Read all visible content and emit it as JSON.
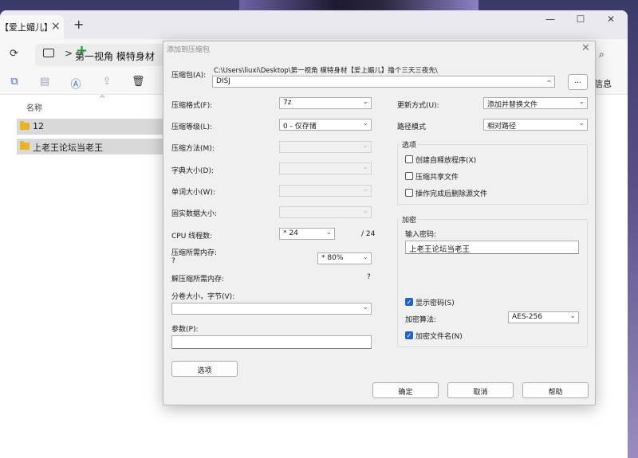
{
  "explorer": {
    "tab_title": "【爱上媚儿】",
    "tab_close": "×",
    "tab_add": "+",
    "win_controls": [
      "—",
      "☐",
      "✕"
    ],
    "refresh_icon": "refresh-icon",
    "breadcrumb_chev": ">",
    "breadcrumb": "第一视角 模特身材",
    "search_icon": "⌕",
    "toolbar_info": "信息",
    "column_name": "名称",
    "sort_caret": "^",
    "files": [
      "12",
      "上老王论坛当老王"
    ]
  },
  "dialog": {
    "title": "添加到压缩包",
    "close": "✕",
    "archive_label": "压缩包(A):",
    "archive_path": "C:\\Users\\liuxi\\Desktop\\第一视角 模特身材【爱上媚儿】撸个三天三夜先\\",
    "archive_name": "DISJ",
    "browse": "...",
    "left": {
      "format_label": "压缩格式(F):",
      "format_value": "7z",
      "level_label": "压缩等级(L):",
      "level_value": "0 - 仅存储",
      "method_label": "压缩方法(M):",
      "dict_label": "字典大小(D):",
      "word_label": "单词大小(W):",
      "solid_label": "固实数据大小:",
      "cpu_label": "CPU 线程数:",
      "cpu_value": "* 24",
      "cpu_max": "/ 24",
      "mem_label": "压缩所需内存:",
      "mem_q": "?",
      "mem_value": "* 80%",
      "decomp_label": "解压缩所需内存:",
      "decomp_value": "?",
      "volume_label": "分卷大小，字节(V):",
      "params_label": "参数(P):",
      "options_button": "选项"
    },
    "right": {
      "update_label": "更新方式(U):",
      "update_value": "添加并替换文件",
      "path_label": "路径模式",
      "path_value": "相对路径",
      "options_group": "选项",
      "opt_sfx": "创建自释放程序(X)",
      "opt_shared": "压缩共享文件",
      "opt_delete": "操作完成后删除源文件",
      "encrypt_group": "加密",
      "password_label": "输入密码:",
      "password_value": "上老王论坛当老王",
      "show_password": "显示密码(S)",
      "enc_method_label": "加密算法:",
      "enc_method_value": "AES-256",
      "enc_names": "加密文件名(N)"
    },
    "buttons": {
      "ok": "确定",
      "cancel": "取消",
      "help": "帮助"
    },
    "check_mark": "✓",
    "arrow": "⌄"
  }
}
